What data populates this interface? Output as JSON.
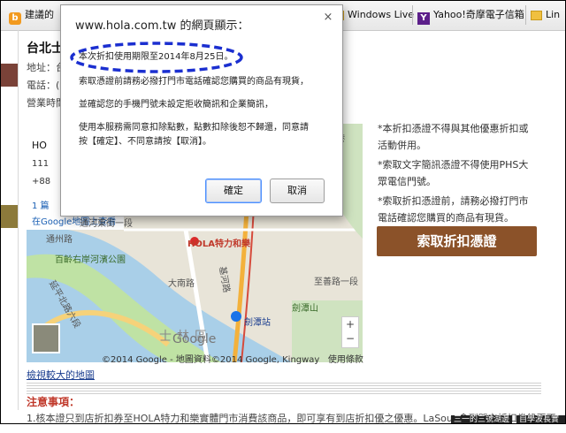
{
  "bookmarks": [
    {
      "label": "建議的",
      "icon": "bookmark-b-icon",
      "color": "#f29a1f"
    },
    {
      "label": "Windows Live",
      "icon": "folder-icon",
      "color": "#f0c040"
    },
    {
      "label": "Yahoo!奇摩電子信箱",
      "icon": "yahoo-icon",
      "color": "#5c1f8a"
    },
    {
      "label": "Lin",
      "icon": "folder-icon",
      "color": "#f0c040"
    }
  ],
  "page": {
    "store_title": "台北士",
    "address_label": "地址：",
    "address_value": "台",
    "phone_label": "電話：(0",
    "hours_label": "營業時間"
  },
  "map": {
    "info_name": "HO",
    "info_line1": "111",
    "info_line2": "+88",
    "info_link1": "1 篇",
    "info_link2": "在Google地圖上查看",
    "pin_label": "HOLA特力和樂",
    "labels": [
      "通州路",
      "百齡右岸河濱公園",
      "延平北路六段",
      "大南路",
      "基河路",
      "劍潭站",
      "劍潭山",
      "士林區",
      "至善路一段",
      "後港",
      "通河東街一段"
    ],
    "google_logo": "Google",
    "copyright": "©2014 Google - 地圖資料©2014 Google, Kingway",
    "terms": "使用條款",
    "zoom_in": "+",
    "zoom_out": "−"
  },
  "right_notes": [
    "*本折扣憑證不得與其他優惠折扣或",
    "活動併用。",
    "*索取文字簡訊憑證不得使用PHS大",
    "眾電信門號。",
    "*索取折扣憑證前，請務必撥打門市",
    "電話確認您購買的商品有現貨。"
  ],
  "claim_button": "索取折扣憑證",
  "view_larger_map": "檢視較大的地圖",
  "notice_title": "注意事項：",
  "notice_line": "1.核本證只到店折扣券至HOLA特力和樂實體門市消費該商品，即可享有到店折扣優之優惠。LaSoua會到門市折扣券錄頁不",
  "corner_tags": [
    "三一的三號湖邊",
    "自學波長實驗"
  ],
  "dialog": {
    "title": "www.hola.com.tw 的網頁顯示：",
    "lines": [
      "本次折扣使用期限至2014年8月25日。",
      "索取憑證前請務必撥打門市電話確認您購買的商品有現貨，",
      "並確認您的手機門號未設定拒收簡訊和企業簡訊，",
      "使用本服務需同意扣除點數，點數扣除後恕不歸還，同意請",
      "按【確定】、不同意請按【取消】。"
    ],
    "ok": "確定",
    "cancel": "取消",
    "close": "×"
  },
  "highlight_color": "#1b2fd0"
}
